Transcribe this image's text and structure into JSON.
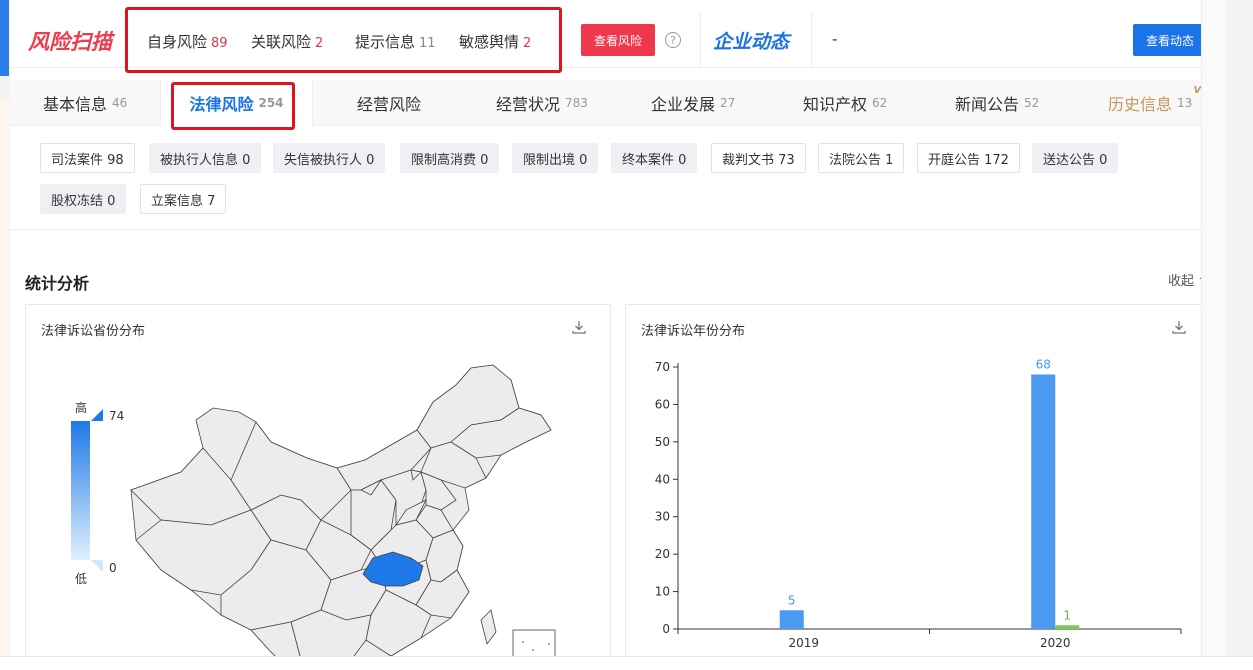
{
  "header": {
    "logo": "风险扫描",
    "risks": [
      {
        "label": "自身风险",
        "count": "89"
      },
      {
        "label": "关联风险",
        "count": "2"
      },
      {
        "label": "提示信息",
        "count": "11"
      },
      {
        "label": "敏感舆情",
        "count": "2"
      }
    ],
    "view_risk_button": "查看风险",
    "help_glyph": "?",
    "dynamics_logo": "企业动态",
    "dynamics_value": "-",
    "view_dynamics_button": "查看动态"
  },
  "tabs": [
    {
      "label": "基本信息",
      "count": "46"
    },
    {
      "label": "法律风险",
      "count": "254"
    },
    {
      "label": "经营风险",
      "count": ""
    },
    {
      "label": "经营状况",
      "count": "783"
    },
    {
      "label": "企业发展",
      "count": "27"
    },
    {
      "label": "知识产权",
      "count": "62"
    },
    {
      "label": "新闻公告",
      "count": "52"
    },
    {
      "label": "历史信息",
      "count": "13",
      "badge": "VIP"
    }
  ],
  "chips": [
    {
      "label": "司法案件 98"
    },
    {
      "label": "被执行人信息 0"
    },
    {
      "label": "失信被执行人 0"
    },
    {
      "label": "限制高消费 0"
    },
    {
      "label": "限制出境 0"
    },
    {
      "label": "终本案件 0"
    },
    {
      "label": "裁判文书 73"
    },
    {
      "label": "法院公告 1"
    },
    {
      "label": "开庭公告 172"
    },
    {
      "label": "送达公告 0"
    },
    {
      "label": "股权冻结 0"
    },
    {
      "label": "立案信息 7"
    }
  ],
  "stats": {
    "title": "统计分析",
    "collapse_label": "收起 ^"
  },
  "map_panel": {
    "title": "法律诉讼省份分布",
    "legend_high": "高",
    "legend_low": "低",
    "legend_max": "74",
    "legend_min": "0",
    "colors": {
      "high": "#1f78e8",
      "low": "#dff1ff",
      "land": "#ececec"
    }
  },
  "chart_panel": {
    "title": "法律诉讼年份分布"
  },
  "chart_data": {
    "type": "bar",
    "categories": [
      "2019",
      "2020"
    ],
    "series": [
      {
        "values": [
          5,
          68
        ],
        "color": "#4a9af0",
        "label_color": "#4a9af0"
      },
      {
        "values": [
          0,
          1
        ],
        "color": "#77cc55",
        "label_color": "#66bb44"
      }
    ],
    "ylim": [
      0,
      70
    ],
    "yticks": [
      0,
      10,
      20,
      30,
      40,
      50,
      60,
      70
    ],
    "value_labels": [
      [
        "5",
        "68"
      ],
      [
        "",
        "1"
      ]
    ]
  }
}
